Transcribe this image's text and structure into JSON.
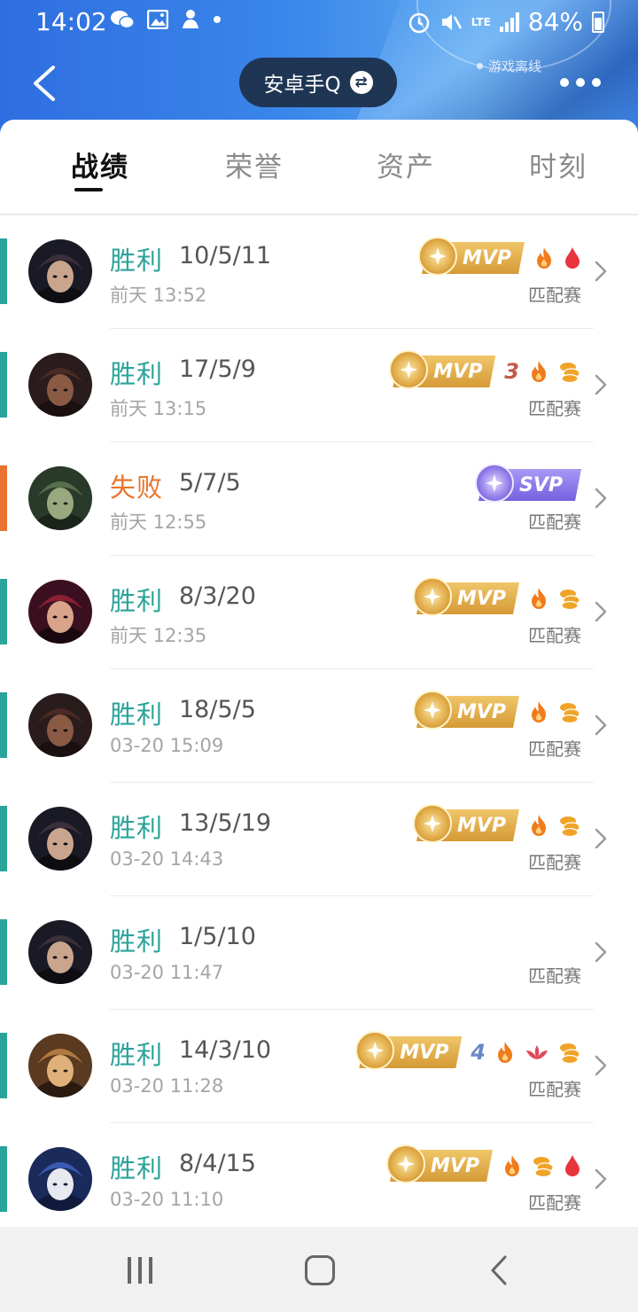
{
  "status_bar": {
    "time": "14:02",
    "battery": "84%",
    "network": "LTE",
    "left_icons": [
      "wechat-icon",
      "gallery-icon",
      "bot-icon",
      "dot-icon"
    ],
    "right_icons": [
      "alarm-icon",
      "mute-icon",
      "lte-icon",
      "signal-icon",
      "battery-icon"
    ]
  },
  "header": {
    "title": "安卓手Q",
    "swap_glyph": "⇄",
    "status_text": "游戏离线"
  },
  "tabs": [
    {
      "label": "战绩",
      "active": true
    },
    {
      "label": "荣誉",
      "active": false
    },
    {
      "label": "资产",
      "active": false
    },
    {
      "label": "时刻",
      "active": false
    }
  ],
  "colors": {
    "win": "#2aa39a",
    "loss": "#e8742f",
    "mvp_gold": "#d59a36",
    "svp_purple": "#7560e0",
    "fire": "#f07b1d",
    "blood": "#e8343c",
    "coin": "#f0a427",
    "nav_bg": "#f1f1f1"
  },
  "matches": [
    {
      "result": "胜利",
      "kda": "10/5/11",
      "time": "前天 13:52",
      "mode": "匹配赛",
      "badge": "MVP",
      "extras": [
        "fire-icon",
        "blood-icon"
      ],
      "number": "",
      "avatar": "hero-dark-hat-avatar"
    },
    {
      "result": "胜利",
      "kda": "17/5/9",
      "time": "前天 13:15",
      "mode": "匹配赛",
      "badge": "MVP",
      "extras": [
        "fire-icon",
        "coin-icon"
      ],
      "number": "3",
      "avatar": "hero-dark-warrior-avatar"
    },
    {
      "result": "失败",
      "kda": "5/7/5",
      "time": "前天 12:55",
      "mode": "匹配赛",
      "badge": "SVP",
      "extras": [],
      "number": "",
      "avatar": "hero-beast-avatar"
    },
    {
      "result": "胜利",
      "kda": "8/3/20",
      "time": "前天 12:35",
      "mode": "匹配赛",
      "badge": "MVP",
      "extras": [
        "fire-icon",
        "coin-icon"
      ],
      "number": "",
      "avatar": "hero-red-hair-avatar"
    },
    {
      "result": "胜利",
      "kda": "18/5/5",
      "time": "03-20 15:09",
      "mode": "匹配赛",
      "badge": "MVP",
      "extras": [
        "fire-icon",
        "coin-icon"
      ],
      "number": "",
      "avatar": "hero-dark-warrior-avatar"
    },
    {
      "result": "胜利",
      "kda": "13/5/19",
      "time": "03-20 14:43",
      "mode": "匹配赛",
      "badge": "MVP",
      "extras": [
        "fire-icon",
        "coin-icon"
      ],
      "number": "",
      "avatar": "hero-dark-hat-avatar"
    },
    {
      "result": "胜利",
      "kda": "1/5/10",
      "time": "03-20 11:47",
      "mode": "匹配赛",
      "badge": "",
      "extras": [],
      "number": "",
      "avatar": "hero-dark-hat-avatar"
    },
    {
      "result": "胜利",
      "kda": "14/3/10",
      "time": "03-20 11:28",
      "mode": "匹配赛",
      "badge": "MVP",
      "extras": [
        "fire-icon",
        "lotus-icon",
        "coin-icon"
      ],
      "number": "4",
      "avatar": "hero-goggles-avatar"
    },
    {
      "result": "胜利",
      "kda": "8/4/15",
      "time": "03-20 11:10",
      "mode": "匹配赛",
      "badge": "MVP",
      "extras": [
        "fire-icon",
        "coin-icon",
        "blood-icon"
      ],
      "number": "",
      "avatar": "hero-white-hair-avatar"
    }
  ]
}
